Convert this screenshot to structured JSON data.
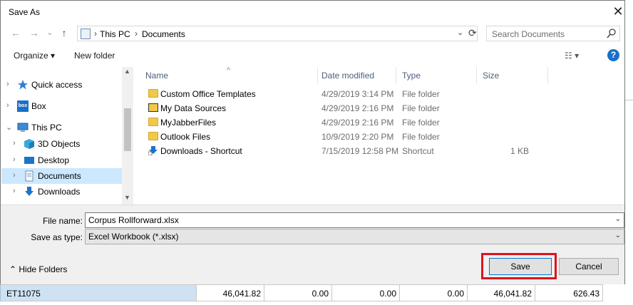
{
  "dialog": {
    "title": "Save As",
    "close_glyph": "✕"
  },
  "nav": {
    "back": "←",
    "forward": "→",
    "recent": "⌄",
    "up": "↑",
    "breadcrumb": [
      "This PC",
      "Documents"
    ],
    "sep": "›",
    "dropdown": "⌄",
    "refresh": "⟳",
    "search_placeholder": "Search Documents"
  },
  "toolbar": {
    "organize": "Organize ▾",
    "new_folder": "New folder",
    "view": "☷ ▾",
    "help": "?"
  },
  "tree": {
    "items": [
      {
        "label": "Quick access",
        "arrow": "›",
        "icon": "star-icon"
      },
      {
        "label": "Box",
        "arrow": "›",
        "icon": "box-icon"
      },
      {
        "label": "This PC",
        "arrow": "⌄",
        "icon": "computer-icon"
      },
      {
        "label": "3D Objects",
        "arrow": "›",
        "icon": "cube-icon"
      },
      {
        "label": "Desktop",
        "arrow": "›",
        "icon": "desktop-icon"
      },
      {
        "label": "Documents",
        "arrow": "›",
        "icon": "documents-icon"
      },
      {
        "label": "Downloads",
        "arrow": "›",
        "icon": "download-icon"
      }
    ],
    "scroll_up": "▲",
    "scroll_down": "▼"
  },
  "columns": {
    "name": "Name",
    "date": "Date modified",
    "type": "Type",
    "size": "Size",
    "sort_caret": "^"
  },
  "files": [
    {
      "name": "Custom Office Templates",
      "date": "4/29/2019 3:14 PM",
      "type": "File folder",
      "size": "",
      "icon": "folder-icon"
    },
    {
      "name": "My Data Sources",
      "date": "4/29/2019 2:16 PM",
      "type": "File folder",
      "size": "",
      "icon": "data-sources-icon"
    },
    {
      "name": "MyJabberFiles",
      "date": "4/29/2019 2:16 PM",
      "type": "File folder",
      "size": "",
      "icon": "folder-icon"
    },
    {
      "name": "Outlook Files",
      "date": "10/9/2019 2:20 PM",
      "type": "File folder",
      "size": "",
      "icon": "folder-icon"
    },
    {
      "name": "Downloads - Shortcut",
      "date": "7/15/2019 12:58 PM",
      "type": "Shortcut",
      "size": "1 KB",
      "icon": "shortcut-icon"
    }
  ],
  "form": {
    "filename_label": "File name:",
    "filename_value": "Corpus Rollforward.xlsx",
    "type_label": "Save as type:",
    "type_value": "Excel Workbook (*.xlsx)",
    "dd_glyph": "⌄"
  },
  "footer": {
    "hide_folders": "⌃ Hide Folders",
    "save": "Save",
    "cancel": "Cancel"
  },
  "background_sheet": {
    "row_id": "ET11075",
    "cells": [
      "46,041.82",
      "0.00",
      "0.00",
      "0.00",
      "46,041.82",
      "626.43"
    ]
  },
  "colors": {
    "accent": "#0078d7",
    "highlight": "#e0121a",
    "selection": "#cce8ff"
  }
}
